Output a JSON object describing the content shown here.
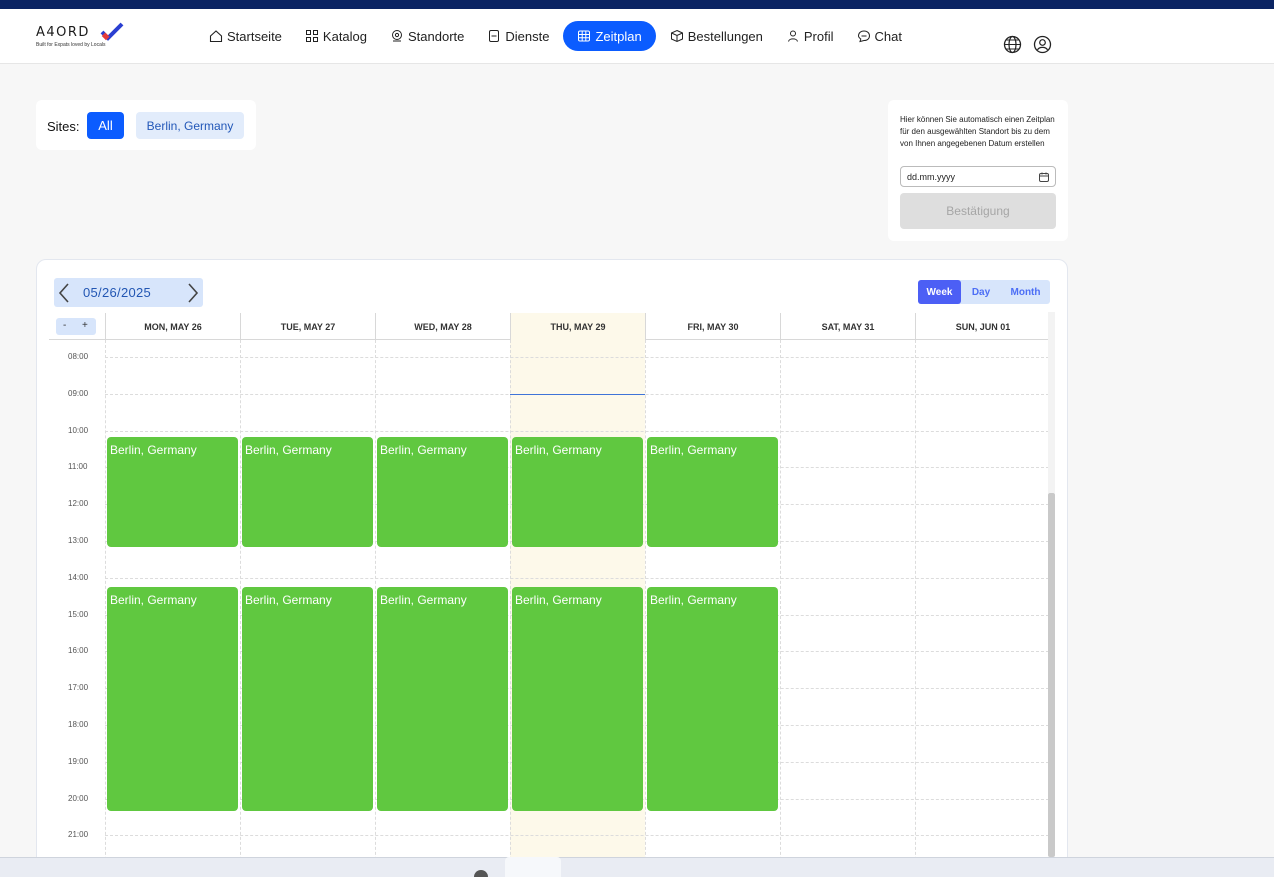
{
  "app": {
    "logo_text": "A4ORD",
    "logo_tagline": "Built for Expats loved by Locals"
  },
  "nav": {
    "items": [
      {
        "label": "Startseite",
        "icon": "home-icon"
      },
      {
        "label": "Katalog",
        "icon": "grid-icon"
      },
      {
        "label": "Standorte",
        "icon": "location-icon"
      },
      {
        "label": "Dienste",
        "icon": "clipboard-icon"
      },
      {
        "label": "Zeitplan",
        "icon": "table-icon",
        "active": true
      },
      {
        "label": "Bestellungen",
        "icon": "box-icon"
      },
      {
        "label": "Profil",
        "icon": "user-icon"
      },
      {
        "label": "Chat",
        "icon": "chat-icon"
      }
    ]
  },
  "sites": {
    "label": "Sites:",
    "all_label": "All",
    "site_label": "Berlin, Germany"
  },
  "auto_schedule": {
    "description": "Hier können Sie automatisch einen Zeitplan für den ausgewählten Standort bis zu dem von Ihnen angegebenen Datum erstellen",
    "date_placeholder": "dd.mm.yyyy",
    "confirm_label": "Bestätigung"
  },
  "calendar": {
    "current_date": "05/26/2025",
    "views": {
      "week": "Week",
      "day": "Day",
      "month": "Month"
    },
    "active_view": "Week",
    "zoom": {
      "minus": "-",
      "plus": "+"
    },
    "days": [
      "MON, MAY 26",
      "TUE, MAY 27",
      "WED, MAY 28",
      "THU, MAY 29",
      "FRI, MAY 30",
      "SAT, MAY 31",
      "SUN, JUN 01"
    ],
    "today_index": 3,
    "hours": [
      "08:00",
      "09:00",
      "10:00",
      "11:00",
      "12:00",
      "13:00",
      "14:00",
      "15:00",
      "16:00",
      "17:00",
      "18:00",
      "19:00",
      "20:00",
      "21:00"
    ],
    "events": [
      {
        "day": 0,
        "start": "10:10",
        "end": "13:10",
        "title": "Berlin, Germany"
      },
      {
        "day": 1,
        "start": "10:10",
        "end": "13:10",
        "title": "Berlin, Germany"
      },
      {
        "day": 2,
        "start": "10:10",
        "end": "13:10",
        "title": "Berlin, Germany"
      },
      {
        "day": 3,
        "start": "10:10",
        "end": "13:10",
        "title": "Berlin, Germany"
      },
      {
        "day": 4,
        "start": "10:10",
        "end": "13:10",
        "title": "Berlin, Germany"
      },
      {
        "day": 0,
        "start": "14:15",
        "end": "20:20",
        "title": "Berlin, Germany"
      },
      {
        "day": 1,
        "start": "14:15",
        "end": "20:20",
        "title": "Berlin, Germany"
      },
      {
        "day": 2,
        "start": "14:15",
        "end": "20:20",
        "title": "Berlin, Germany"
      },
      {
        "day": 3,
        "start": "14:15",
        "end": "20:20",
        "title": "Berlin, Germany"
      },
      {
        "day": 4,
        "start": "14:15",
        "end": "20:20",
        "title": "Berlin, Germany"
      }
    ],
    "now_time": "09:00"
  },
  "colors": {
    "brand_blue": "#0b5cff",
    "event_green": "#60c840",
    "today_bg": "#fdf9ea",
    "top_strip": "#0b2463"
  }
}
